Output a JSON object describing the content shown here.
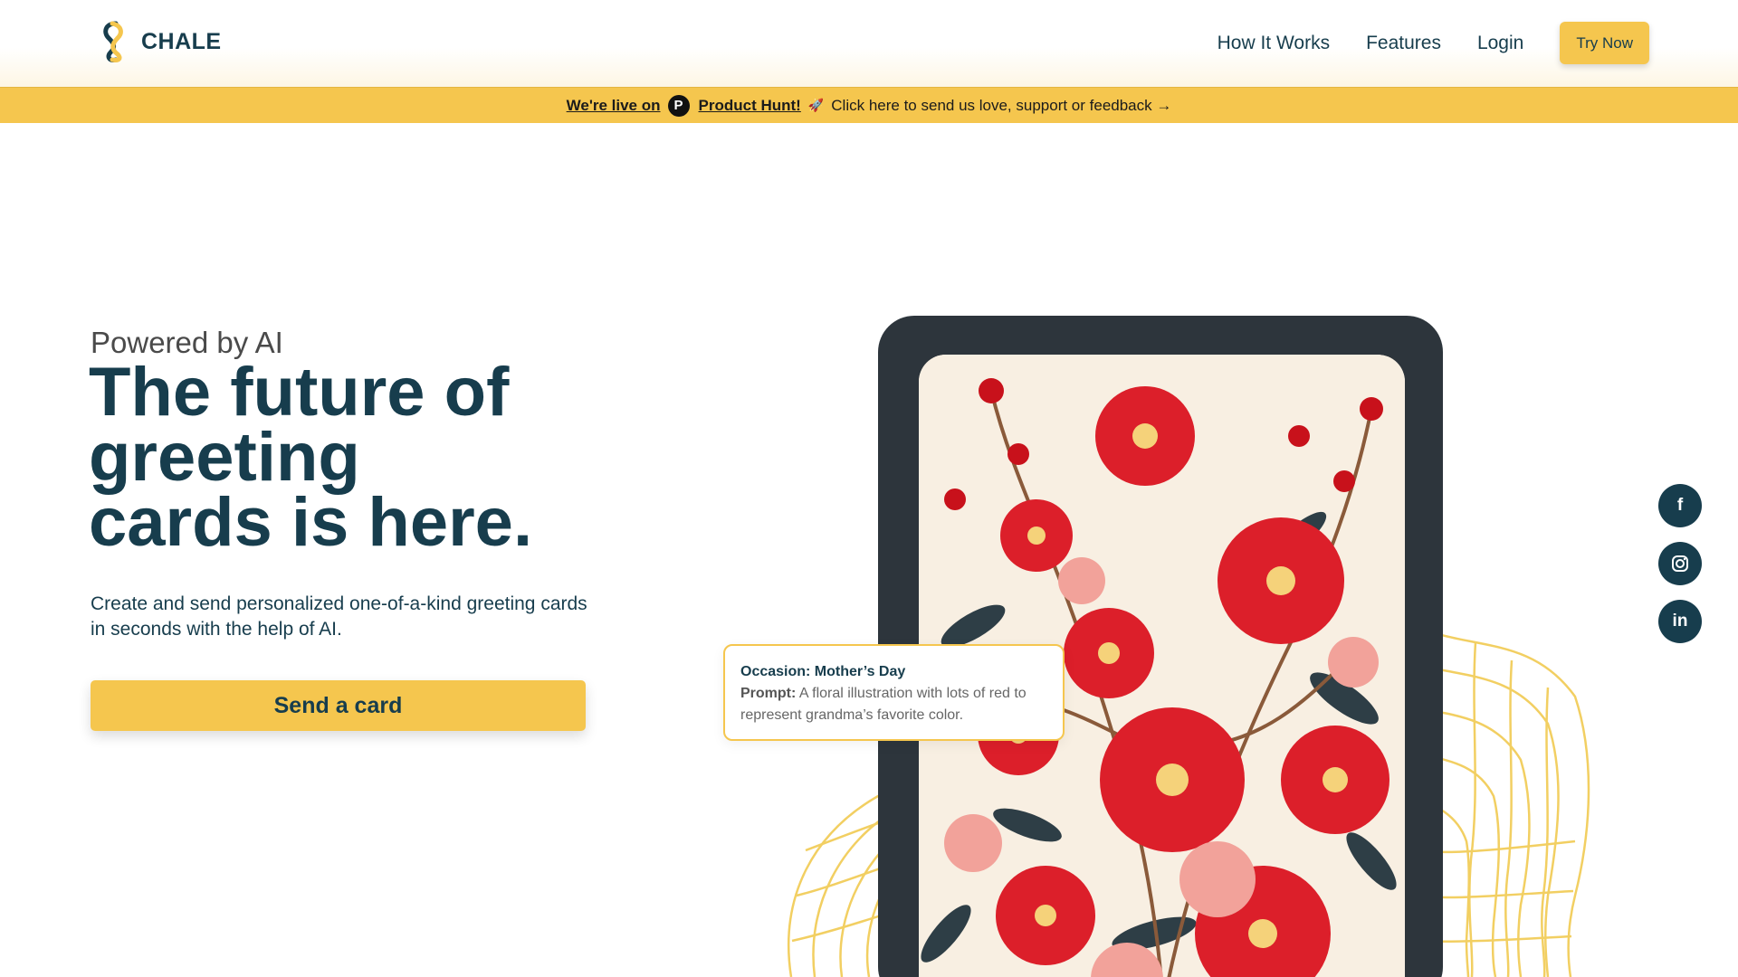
{
  "header": {
    "logo_text": "CHALE",
    "nav": [
      "How It Works",
      "Features",
      "Login"
    ],
    "cta_label": "Try Now"
  },
  "banner": {
    "live_text": "We're live on",
    "ph_badge": "P",
    "ph_text": "Product Hunt!",
    "rocket": "🚀",
    "message": "Click here to send us love, support or feedback →"
  },
  "hero": {
    "eyebrow": "Powered by AI",
    "title_lines": [
      "The future of",
      "greeting",
      "cards is here."
    ],
    "subtitle": "Create and send personalized one-of-a-kind greeting cards in seconds with the help of AI.",
    "button_label": "Send a card"
  },
  "example": {
    "occasion": "Occasion: Mother’s Day",
    "prompt_label": "Prompt:",
    "prompt_text": "A floral illustration with lots of red to represent grandma’s favorite color."
  },
  "social": [
    {
      "icon": "facebook-icon",
      "glyph": "f"
    },
    {
      "icon": "instagram-icon",
      "glyph": "◎"
    },
    {
      "icon": "linkedin-icon",
      "glyph": "in"
    }
  ],
  "colors": {
    "brand_dark": "#173d4d",
    "accent_yellow": "#f5c64e",
    "device_frame": "#2d353c",
    "flower_red": "#d8222c"
  }
}
